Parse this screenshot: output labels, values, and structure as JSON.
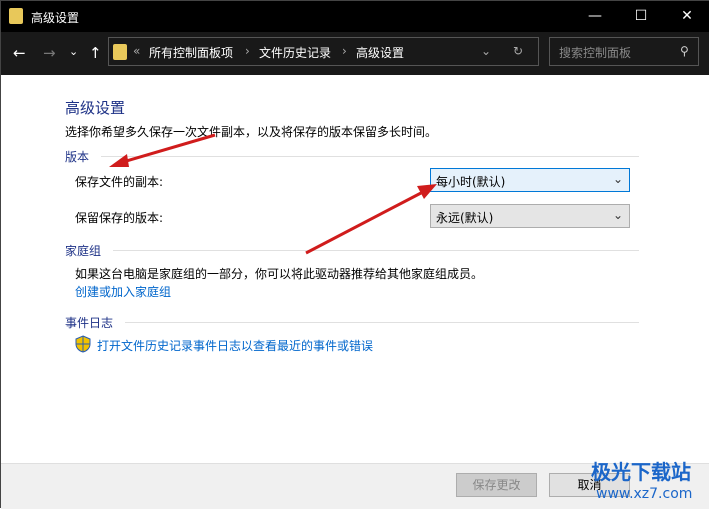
{
  "window": {
    "title": "高级设置",
    "minimize": "—",
    "maximize": "☐",
    "close": "✕"
  },
  "nav": {
    "back": "←",
    "forward": "→",
    "recent": "⌄",
    "up": "↑",
    "breadcrumb": [
      "所有控制面板项",
      "文件历史记录",
      "高级设置"
    ],
    "refresh": "↻",
    "dropdown": "⌄",
    "search_placeholder": "搜索控制面板",
    "search_icon": "⚲"
  },
  "main": {
    "title": "高级设置",
    "description": "选择你希望多久保存一次文件副本，以及将保存的版本保留多长时间。",
    "versions": {
      "heading": "版本",
      "copy_label": "保存文件的副本:",
      "copy_value": "每小时(默认)",
      "keep_label": "保留保存的版本:",
      "keep_value": "永远(默认)"
    },
    "homegroup": {
      "heading": "家庭组",
      "text": "如果这台电脑是家庭组的一部分，你可以将此驱动器推荐给其他家庭组成员。",
      "link": "创建或加入家庭组"
    },
    "eventlog": {
      "heading": "事件日志",
      "link": "打开文件历史记录事件日志以查看最近的事件或错误",
      "icon": "shield-icon"
    }
  },
  "footer": {
    "save": "保存更改",
    "cancel": "取消"
  },
  "watermark": {
    "name": "极光下载站",
    "url": "www.xz7.com"
  },
  "colors": {
    "heading": "#1e3287",
    "link": "#0066cc",
    "arrow": "#d01c1c"
  }
}
